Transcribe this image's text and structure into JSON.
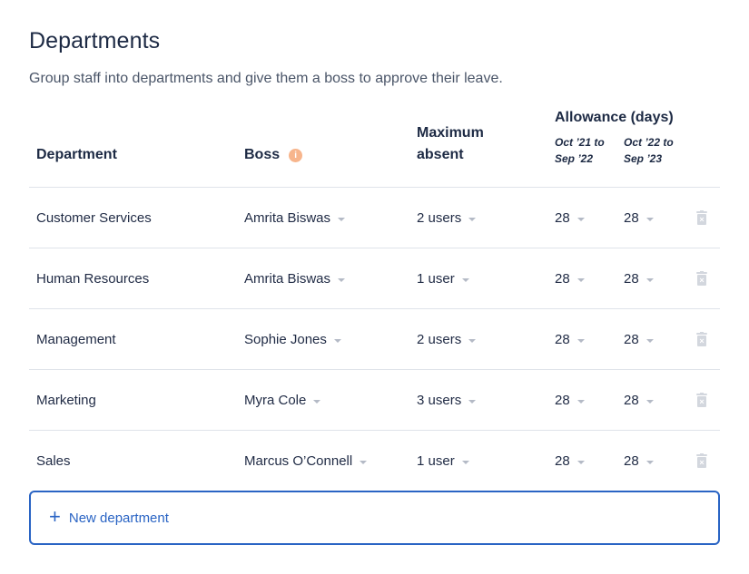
{
  "page": {
    "title": "Departments",
    "subtitle": "Group staff into departments and give them a boss to approve their leave."
  },
  "table": {
    "headers": {
      "department": "Department",
      "boss": "Boss",
      "boss_info_icon": "info-icon",
      "max_absent": "Maximum absent",
      "allowance": "Allowance (days)",
      "period1": "Oct ’21 to Sep ’22",
      "period2": "Oct ’22 to Sep ’23"
    },
    "rows": [
      {
        "department": "Customer Services",
        "boss": "Amrita Biswas",
        "max_absent": "2 users",
        "allowance1": "28",
        "allowance2": "28"
      },
      {
        "department": "Human Resources",
        "boss": "Amrita Biswas",
        "max_absent": "1 user",
        "allowance1": "28",
        "allowance2": "28"
      },
      {
        "department": "Management",
        "boss": "Sophie Jones",
        "max_absent": "2 users",
        "allowance1": "28",
        "allowance2": "28"
      },
      {
        "department": "Marketing",
        "boss": "Myra Cole",
        "max_absent": "3 users",
        "allowance1": "28",
        "allowance2": "28"
      },
      {
        "department": "Sales",
        "boss": "Marcus O’Connell",
        "max_absent": "1 user",
        "allowance1": "28",
        "allowance2": "28"
      }
    ]
  },
  "actions": {
    "new_department": "New department",
    "new_icon": "plus-icon",
    "delete_icon": "trash-icon"
  },
  "colors": {
    "accent": "#2a64c4",
    "info_badge": "#f7b58c",
    "divider": "#dfe3ea"
  }
}
